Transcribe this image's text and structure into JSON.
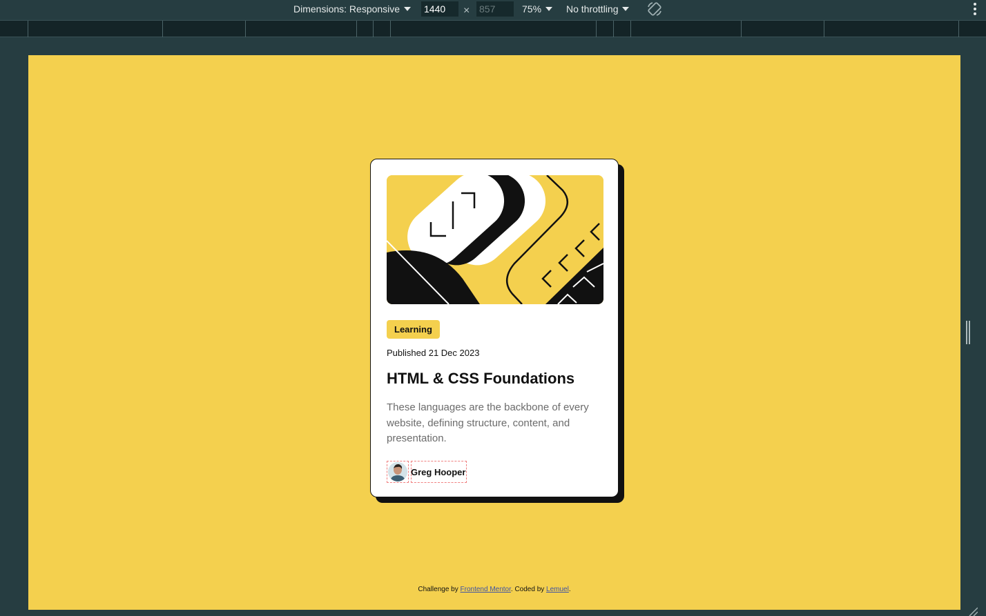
{
  "toolbar": {
    "dimensions_label": "Dimensions: Responsive",
    "width_value": "1440",
    "times_symbol": "×",
    "height_placeholder": "857",
    "zoom_label": "75%",
    "throttling_label": "No throttling",
    "rotate_icon": "rotate-icon",
    "more_icon": "kebab-menu-icon"
  },
  "page": {
    "background_color": "#f4d04e",
    "card": {
      "hero_image": "illustration-article",
      "tag": "Learning",
      "published": "Published 21 Dec 2023",
      "title": "HTML & CSS Foundations",
      "description": "These languages are the backbone of every website, defining structure, content, and presentation.",
      "author_avatar": "avatar",
      "author_name": "Greg Hooper"
    },
    "attribution": {
      "prefix": "Challenge by ",
      "link1": "Frontend Mentor",
      "middle": ". Coded by ",
      "link2": "Lemuel",
      "suffix": "."
    }
  }
}
